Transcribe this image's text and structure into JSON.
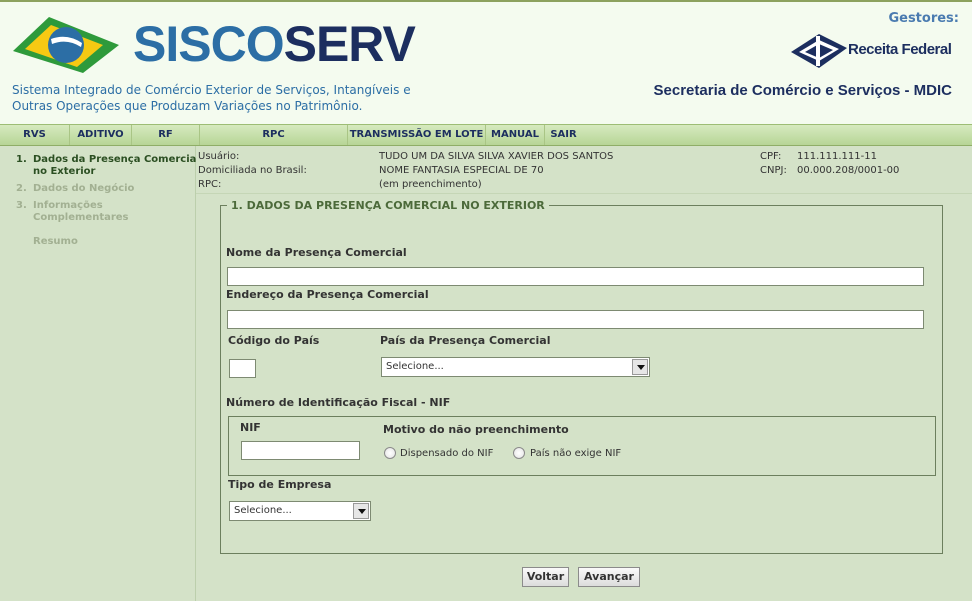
{
  "header": {
    "brand_part1": "SISCO",
    "brand_part2": "SERV",
    "subtitle_line1": "Sistema Integrado de Comércio Exterior de Serviços, Intangíveis e",
    "subtitle_line2": "Outras Operações que Produzam Variações no Patrimônio.",
    "gestores": "Gestores:",
    "receita": "Receita Federal",
    "secretaria": "Secretaria de Comércio e Serviços - MDIC",
    "colors": {
      "brand_blue": "#2c6ea5",
      "brand_navy": "#1c2e5f",
      "logo_green": "#2e9a3b",
      "logo_yellow": "#f6c913"
    }
  },
  "menu": {
    "items": [
      {
        "label": "RVS"
      },
      {
        "label": "ADITIVO"
      },
      {
        "label": "RF"
      },
      {
        "label": "RPC"
      },
      {
        "label": "TRANSMISSÃO EM LOTE"
      },
      {
        "label": "MANUAL"
      },
      {
        "label": "SAIR"
      }
    ]
  },
  "sidebar": {
    "steps": [
      {
        "number": "1.",
        "label": "Dados da Presença Comercial no Exterior",
        "state": "active"
      },
      {
        "number": "2.",
        "label": "Dados do Negócio",
        "state": "inactive"
      },
      {
        "number": "3.",
        "label": "Informações Complementares",
        "state": "inactive"
      },
      {
        "number": "",
        "label": "Resumo",
        "state": "inactive"
      }
    ]
  },
  "info": {
    "usuario_label": "Usuário:",
    "usuario_value": "TUDO UM DA SILVA SILVA XAVIER DOS SANTOS",
    "domiciliada_label": "Domiciliada no Brasil:",
    "domiciliada_value": "NOME FANTASIA ESPECIAL DE 70",
    "rpc_label": "RPC:",
    "rpc_value": "(em preenchimento)",
    "cpf_label": "CPF:",
    "cpf_value": "111.111.111-11",
    "cnpj_label": "CNPJ:",
    "cnpj_value": "00.000.208/0001-00"
  },
  "form": {
    "legend": "1. DADOS DA PRESENÇA COMERCIAL NO EXTERIOR",
    "nome_label": "Nome da Presença Comercial",
    "nome_value": "",
    "endereco_label": "Endereço da Presença Comercial",
    "endereco_value": "",
    "codigo_pais_label": "Código do País",
    "codigo_pais_value": "",
    "pais_label": "País da Presença Comercial",
    "pais_selected": "Selecione...",
    "nif_section_label": "Número de Identificação Fiscal - NIF",
    "nif_label": "NIF",
    "nif_value": "",
    "motivo_label": "Motivo do não preenchimento",
    "radio_dispensado": "Dispensado do NIF",
    "radio_pais": "País não exige NIF",
    "tipo_label": "Tipo de Empresa",
    "tipo_selected": "Selecione..."
  },
  "buttons": {
    "voltar": "Voltar",
    "avancar": "Avançar"
  }
}
